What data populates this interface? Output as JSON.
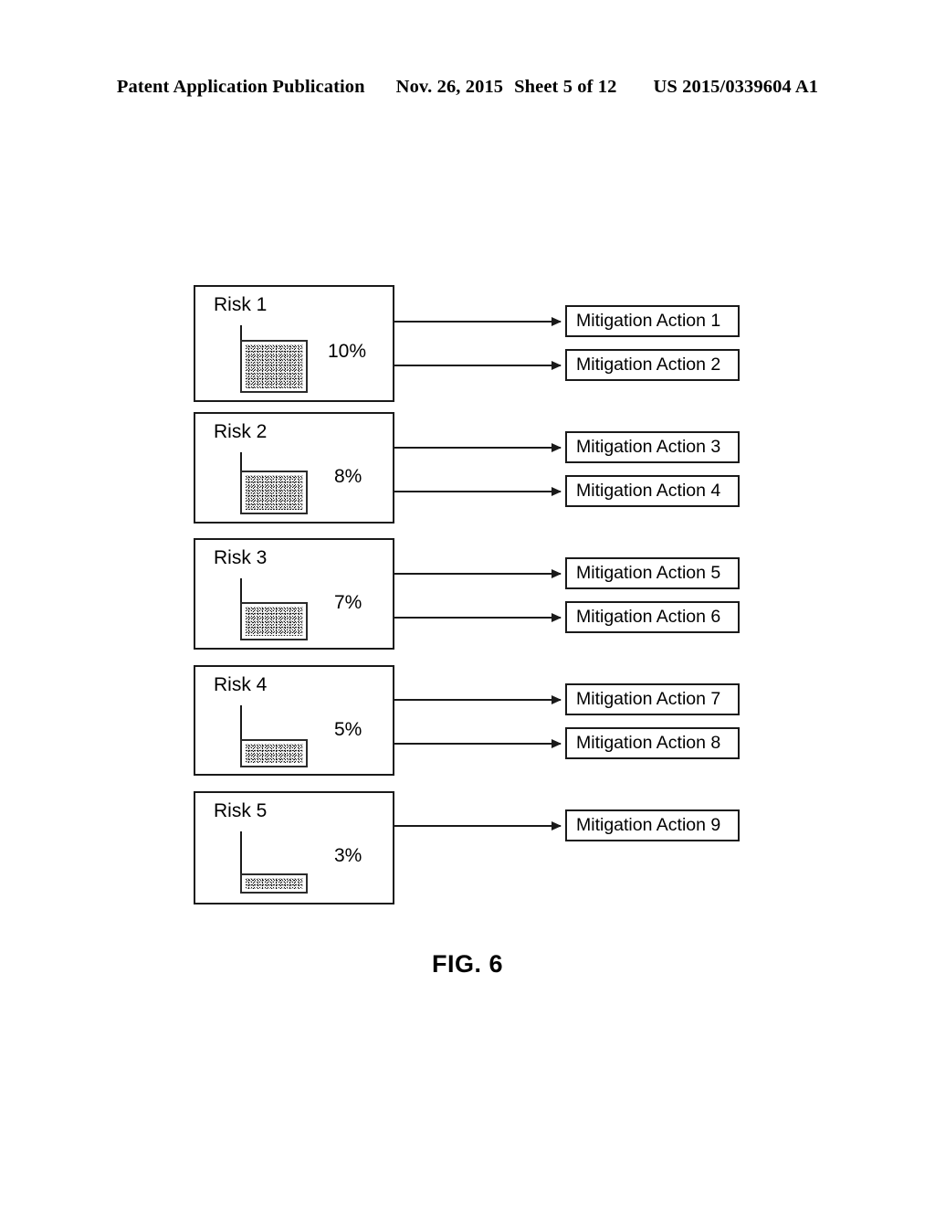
{
  "header": {
    "publication": "Patent Application Publication",
    "date": "Nov. 26, 2015",
    "sheet": "Sheet 5 of 12",
    "patent_number": "US 2015/0339604 A1"
  },
  "figure": {
    "caption": "FIG. 6"
  },
  "chart_data": {
    "type": "bar",
    "title": "FIG. 6",
    "xlabel": "",
    "ylabel": "",
    "categories": [
      "Risk 1",
      "Risk 2",
      "Risk 3",
      "Risk 4",
      "Risk 5"
    ],
    "values": [
      10,
      8,
      7,
      5,
      3
    ],
    "value_labels": [
      "10%",
      "8%",
      "7%",
      "5%",
      "3%"
    ],
    "unit": "%",
    "ylim": [
      0,
      10
    ],
    "grid": false,
    "legend": null,
    "note": "Each risk is rendered as its own small bar panel; bar height is proportional to the percentage."
  },
  "risks": [
    {
      "id": "risk-1",
      "label": "Risk 1",
      "percent_label": "10%",
      "percent_value": 10,
      "mitigations": [
        "mitigation-action-1",
        "mitigation-action-2"
      ]
    },
    {
      "id": "risk-2",
      "label": "Risk 2",
      "percent_label": "8%",
      "percent_value": 8,
      "mitigations": [
        "mitigation-action-3",
        "mitigation-action-4"
      ]
    },
    {
      "id": "risk-3",
      "label": "Risk 3",
      "percent_label": "7%",
      "percent_value": 7,
      "mitigations": [
        "mitigation-action-5",
        "mitigation-action-6"
      ]
    },
    {
      "id": "risk-4",
      "label": "Risk 4",
      "percent_label": "5%",
      "percent_value": 5,
      "mitigations": [
        "mitigation-action-7",
        "mitigation-action-8"
      ]
    },
    {
      "id": "risk-5",
      "label": "Risk 5",
      "percent_label": "3%",
      "percent_value": 3,
      "mitigations": [
        "mitigation-action-9"
      ]
    }
  ],
  "mitigations": [
    {
      "id": "mitigation-action-1",
      "label": "Mitigation Action 1"
    },
    {
      "id": "mitigation-action-2",
      "label": "Mitigation Action 2"
    },
    {
      "id": "mitigation-action-3",
      "label": "Mitigation Action 3"
    },
    {
      "id": "mitigation-action-4",
      "label": "Mitigation Action 4"
    },
    {
      "id": "mitigation-action-5",
      "label": "Mitigation Action 5"
    },
    {
      "id": "mitigation-action-6",
      "label": "Mitigation Action 6"
    },
    {
      "id": "mitigation-action-7",
      "label": "Mitigation Action 7"
    },
    {
      "id": "mitigation-action-8",
      "label": "Mitigation Action 8"
    },
    {
      "id": "mitigation-action-9",
      "label": "Mitigation Action 9"
    }
  ],
  "colors": {
    "ink": "#1a1a1a",
    "page": "#ffffff",
    "bar_fill": "#f2f2f2"
  }
}
